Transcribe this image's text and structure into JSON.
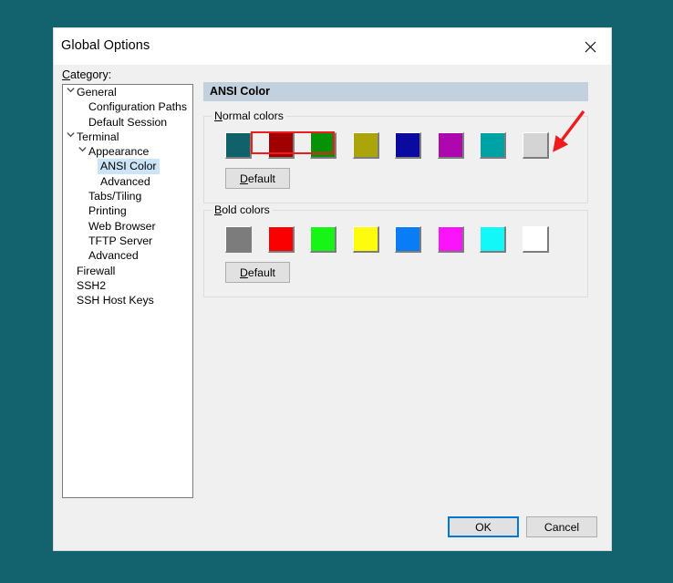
{
  "desktop": {
    "background": "#13636e"
  },
  "window": {
    "title": "Global Options",
    "close_icon": "close-icon"
  },
  "category": {
    "label": "Category:",
    "label_mnemonic": "C",
    "tree": [
      {
        "label": "General",
        "indent": 0,
        "chevron": "v",
        "selected": false
      },
      {
        "label": "Configuration Paths",
        "indent": 1,
        "chevron": "",
        "selected": false
      },
      {
        "label": "Default Session",
        "indent": 1,
        "chevron": "",
        "selected": false
      },
      {
        "label": "Terminal",
        "indent": 0,
        "chevron": "v",
        "selected": false
      },
      {
        "label": "Appearance",
        "indent": 1,
        "chevron": "v",
        "selected": false
      },
      {
        "label": "ANSI Color",
        "indent": 2,
        "chevron": "",
        "selected": true
      },
      {
        "label": "Advanced",
        "indent": 2,
        "chevron": "",
        "selected": false
      },
      {
        "label": "Tabs/Tiling",
        "indent": 1,
        "chevron": "",
        "selected": false
      },
      {
        "label": "Printing",
        "indent": 1,
        "chevron": "",
        "selected": false
      },
      {
        "label": "Web Browser",
        "indent": 1,
        "chevron": "",
        "selected": false
      },
      {
        "label": "TFTP Server",
        "indent": 1,
        "chevron": "",
        "selected": false
      },
      {
        "label": "Advanced",
        "indent": 1,
        "chevron": "",
        "selected": false
      },
      {
        "label": "Firewall",
        "indent": 0,
        "chevron": "",
        "selected": false
      },
      {
        "label": "SSH2",
        "indent": 0,
        "chevron": "",
        "selected": false
      },
      {
        "label": "SSH Host Keys",
        "indent": 0,
        "chevron": "",
        "selected": false
      }
    ]
  },
  "pane": {
    "header": "ANSI Color",
    "header_background": "#c3d0de",
    "normal_group": {
      "title": "Normal colors",
      "mnemonic": "N",
      "default_button": "Default",
      "default_button_mnemonic": "D",
      "swatches": [
        {
          "name": "black",
          "color": "#106169"
        },
        {
          "name": "red",
          "color": "#a10000"
        },
        {
          "name": "green",
          "color": "#069206"
        },
        {
          "name": "yellow",
          "color": "#aba50b"
        },
        {
          "name": "blue",
          "color": "#0a0a9e"
        },
        {
          "name": "magenta",
          "color": "#ad07ad"
        },
        {
          "name": "cyan",
          "color": "#00a3a5"
        },
        {
          "name": "white",
          "color": "#d4d4d4"
        }
      ]
    },
    "bold_group": {
      "title": "Bold colors",
      "mnemonic": "B",
      "default_button": "Default",
      "default_button_mnemonic": "D",
      "swatches": [
        {
          "name": "bright-black",
          "color": "#7c7c7c"
        },
        {
          "name": "bright-red",
          "color": "#fb0000"
        },
        {
          "name": "bright-green",
          "color": "#16f516"
        },
        {
          "name": "bright-yellow",
          "color": "#fcfc0c"
        },
        {
          "name": "bright-blue",
          "color": "#0a7cf5"
        },
        {
          "name": "bright-magenta",
          "color": "#fb14fb"
        },
        {
          "name": "bright-cyan",
          "color": "#12f8f8"
        },
        {
          "name": "bright-white",
          "color": "#ffffff"
        }
      ]
    }
  },
  "footer": {
    "ok": "OK",
    "cancel": "Cancel",
    "focus_color": "#0078d7"
  },
  "annotations": {
    "highlight_color": "#ee1c1c",
    "rect_target": "Normal colors",
    "arrow_target": "normal-swatch-white"
  }
}
